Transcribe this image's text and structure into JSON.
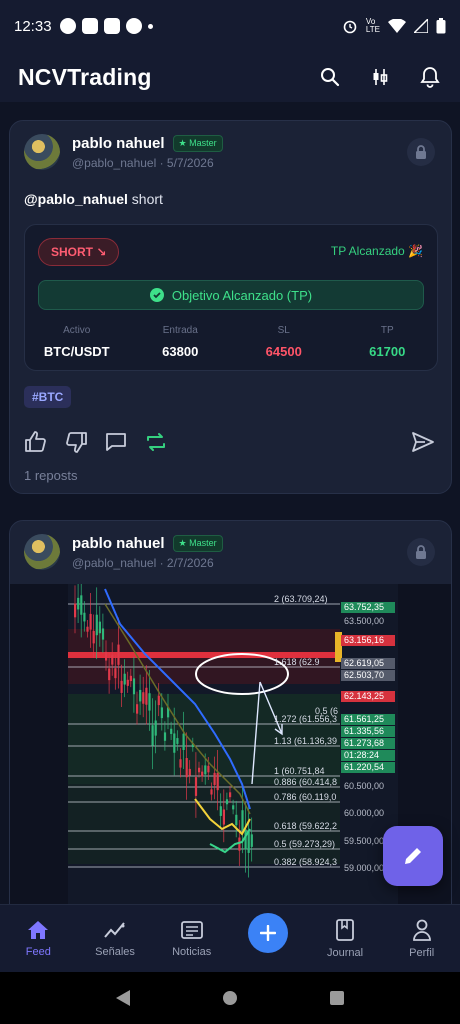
{
  "status_bar": {
    "time": "12:33"
  },
  "app": {
    "title": "NCVTrading"
  },
  "posts": [
    {
      "author": "pablo nahuel",
      "badge": "★ Master",
      "handle": "@pablo_nahuel · 5/7/2026",
      "mention": "@pablo_nahuel",
      "text": " short",
      "signal": {
        "direction": "SHORT ↘",
        "status": "TP Alcanzado 🎉",
        "objective": "Objetivo Alcanzado (TP)",
        "stats": [
          {
            "label": "Activo",
            "value": "BTC/USDT"
          },
          {
            "label": "Entrada",
            "value": "63800"
          },
          {
            "label": "SL",
            "value": "64500"
          },
          {
            "label": "TP",
            "value": "61700"
          }
        ]
      },
      "tag": "#BTC",
      "reposts": "1 reposts"
    },
    {
      "author": "pablo nahuel",
      "badge": "★ Master",
      "handle": "@pablo_nahuel · 2/7/2026"
    }
  ],
  "chart_image": {
    "fib_labels": [
      "2 (63.709,24)",
      "1.618 (62.9",
      "1.272 (61.556,3",
      "1.13 (61.136,39",
      "1 (60.751,84",
      "0.886 (60.414,8",
      "0.786 (60.119,0",
      "0.618 (59.622,2",
      "0.5 (59.273,29)",
      "0.382 (58.924,3",
      "0,5 (6"
    ],
    "price_axis": [
      "63.752,35",
      "63.500,00",
      "63.156,16",
      "62.619,05",
      "62.503,70",
      "62.143,25",
      "61.561,25",
      "61.335,56",
      "61.273,68",
      "01:28:24",
      "61.220,54",
      "60.500,00",
      "60.000,00",
      "59.500,00",
      "59.000,00"
    ]
  },
  "bottom_nav": [
    {
      "label": "Feed",
      "icon": "home-icon"
    },
    {
      "label": "Señales",
      "icon": "signals-icon"
    },
    {
      "label": "Noticias",
      "icon": "news-icon"
    },
    {
      "label": "Journal",
      "icon": "journal-icon"
    },
    {
      "label": "Perfil",
      "icon": "profile-icon"
    }
  ],
  "colors": {
    "accent": "#7f77ff",
    "green": "#37d987",
    "red": "#ff5468",
    "bg": "#0f1424",
    "card": "#1b2236"
  }
}
